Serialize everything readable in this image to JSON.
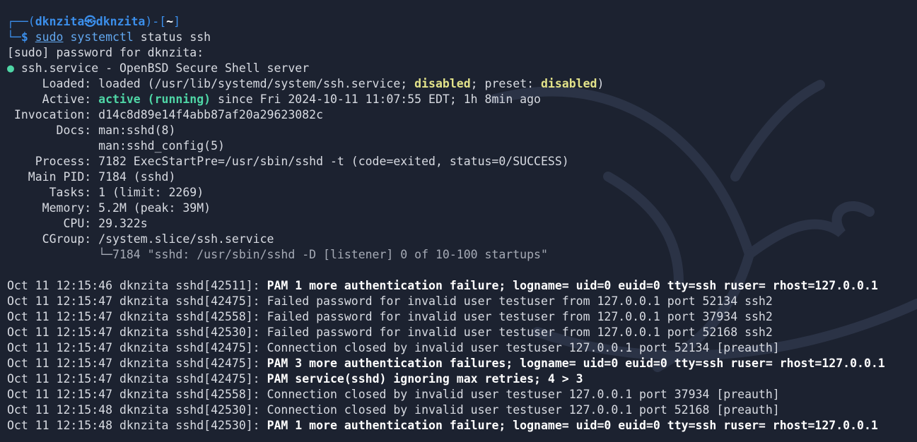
{
  "prompt": {
    "corner_top": "┌──(",
    "user": "dknzita",
    "at_symbol": "㉿",
    "host": "dknzita",
    "mid": ")-[",
    "cwd": "~",
    "end": "]",
    "corner_bottom": "└─",
    "dollar": "$ ",
    "cmd_sudo": "sudo",
    "cmd_systemctl": "systemctl",
    "cmd_args": " status ssh"
  },
  "sudo_prompt": "[sudo] password for dknzita:",
  "service": {
    "bullet": "●",
    "title": " ssh.service - OpenBSD Secure Shell server",
    "loaded_label": "     Loaded: ",
    "loaded_pre": "loaded (/usr/lib/systemd/system/ssh.service; ",
    "loaded_state": "disabled",
    "loaded_mid": "; preset: ",
    "loaded_preset": "disabled",
    "loaded_end": ")",
    "active_label": "     Active: ",
    "active_state": "active (running)",
    "active_rest": " since Fri 2024-10-11 11:07:55 EDT; 1h 8min ago",
    "invocation": " Invocation: d14c8d89e14f4abb87af20a29623082c",
    "docs1": "       Docs: man:sshd(8)",
    "docs2": "             man:sshd_config(5)",
    "process": "    Process: 7182 ExecStartPre=/usr/sbin/sshd -t (code=exited, status=0/SUCCESS)",
    "main_pid": "   Main PID: 7184 (sshd)",
    "tasks": "      Tasks: 1 (limit: 2269)",
    "memory": "     Memory: 5.2M (peak: 39M)",
    "cpu": "        CPU: 29.322s",
    "cgroup": "     CGroup: /system.slice/ssh.service",
    "cgroup_child": "             └─7184 \"sshd: /usr/sbin/sshd -D [listener] 0 of 10-100 startups\""
  },
  "logs": [
    {
      "prefix": "Oct 11 12:15:46 dknzita sshd[42511]: ",
      "msg": "PAM 1 more authentication failure; logname= uid=0 euid=0 tty=ssh ruser= rhost=127.0.0.1",
      "bold": true
    },
    {
      "prefix": "Oct 11 12:15:47 dknzita sshd[42475]: ",
      "msg": "Failed password for invalid user testuser from 127.0.0.1 port 52134 ssh2",
      "bold": false
    },
    {
      "prefix": "Oct 11 12:15:47 dknzita sshd[42558]: ",
      "msg": "Failed password for invalid user testuser from 127.0.0.1 port 37934 ssh2",
      "bold": false
    },
    {
      "prefix": "Oct 11 12:15:47 dknzita sshd[42530]: ",
      "msg": "Failed password for invalid user testuser from 127.0.0.1 port 52168 ssh2",
      "bold": false
    },
    {
      "prefix": "Oct 11 12:15:47 dknzita sshd[42475]: ",
      "msg": "Connection closed by invalid user testuser 127.0.0.1 port 52134 [preauth]",
      "bold": false
    },
    {
      "prefix": "Oct 11 12:15:47 dknzita sshd[42475]: ",
      "msg": "PAM 3 more authentication failures; logname= uid=0 euid=0 tty=ssh ruser= rhost=127.0.0.1",
      "bold": true
    },
    {
      "prefix": "Oct 11 12:15:47 dknzita sshd[42475]: ",
      "msg": "PAM service(sshd) ignoring max retries; 4 > 3",
      "bold": true
    },
    {
      "prefix": "Oct 11 12:15:47 dknzita sshd[42558]: ",
      "msg": "Connection closed by invalid user testuser 127.0.0.1 port 37934 [preauth]",
      "bold": false
    },
    {
      "prefix": "Oct 11 12:15:48 dknzita sshd[42530]: ",
      "msg": "Connection closed by invalid user testuser 127.0.0.1 port 52168 [preauth]",
      "bold": false
    },
    {
      "prefix": "Oct 11 12:15:48 dknzita sshd[42530]: ",
      "msg": "PAM 1 more authentication failure; logname= uid=0 euid=0 tty=ssh ruser= rhost=127.0.0.1",
      "bold": true
    }
  ],
  "colors": {
    "background": "#1c2230",
    "prompt_blue": "#3b8eea",
    "status_green": "#4fd6a6",
    "disabled_yellow": "#e3e38a"
  }
}
